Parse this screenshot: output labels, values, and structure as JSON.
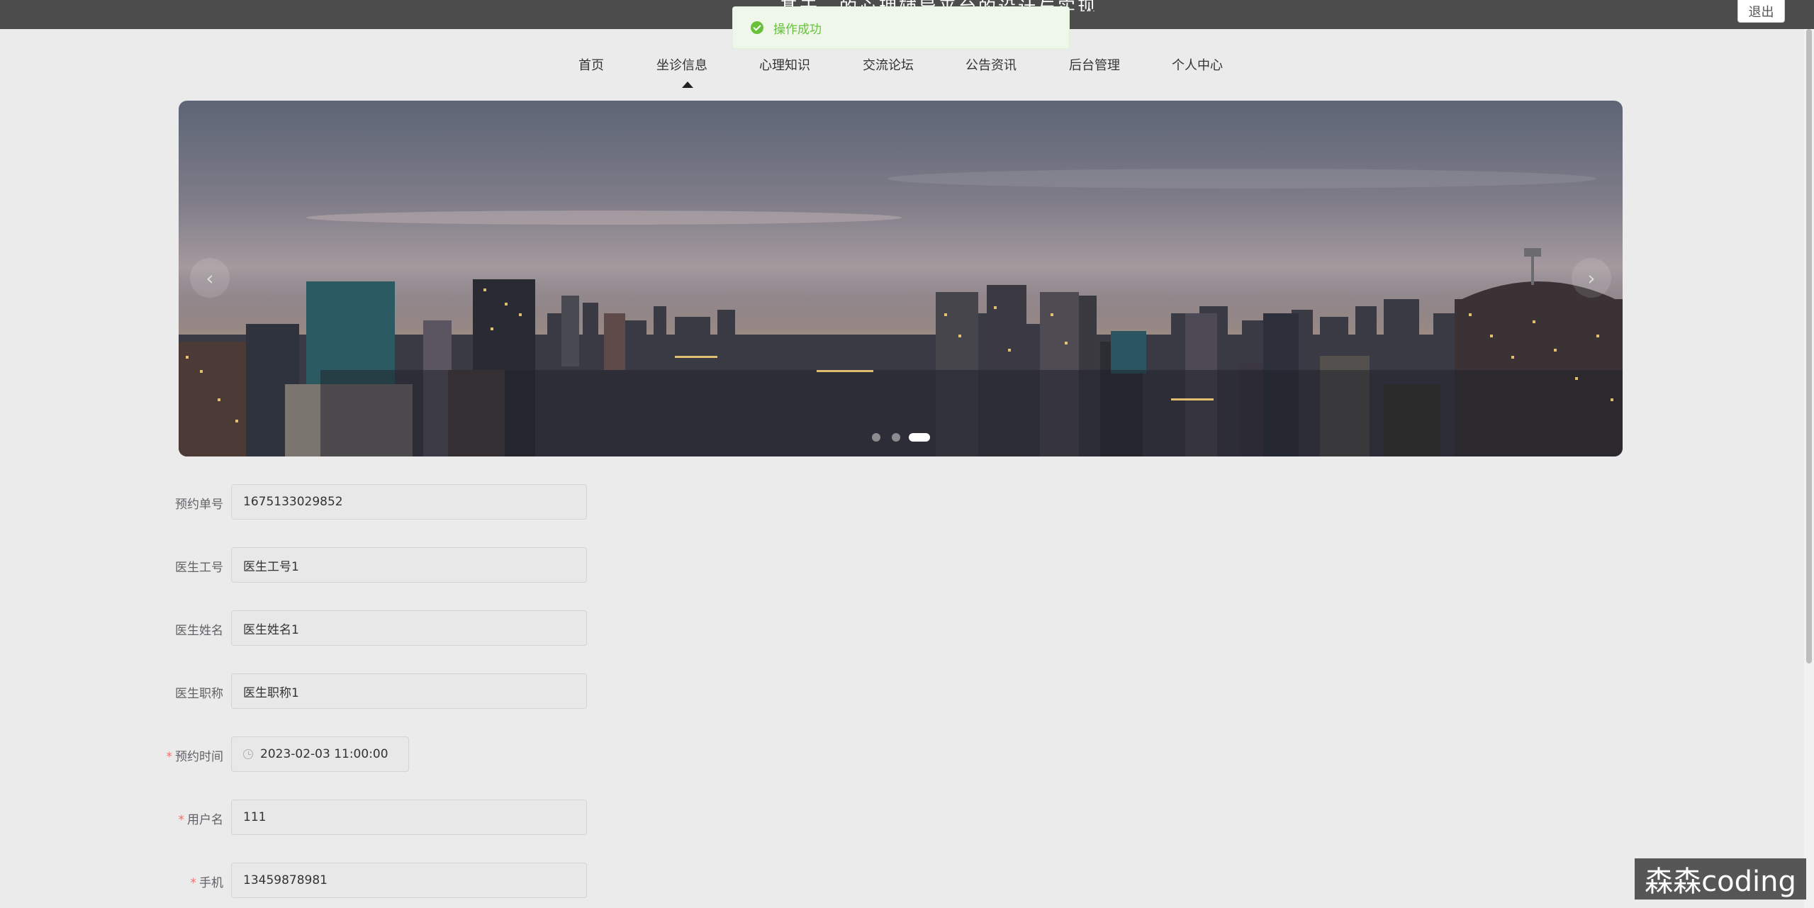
{
  "header": {
    "site_title": "基于…的心理辅导平台的设计与实现",
    "logout_label": "退出"
  },
  "toast": {
    "message": "操作成功",
    "icon": "check-circle-icon",
    "color": "#67c23a"
  },
  "nav": {
    "items": [
      {
        "label": "首页"
      },
      {
        "label": "坐诊信息",
        "active": true
      },
      {
        "label": "心理知识"
      },
      {
        "label": "交流论坛"
      },
      {
        "label": "公告资讯"
      },
      {
        "label": "后台管理"
      },
      {
        "label": "个人中心"
      }
    ]
  },
  "carousel": {
    "prev_label": "‹",
    "next_label": "›",
    "slide_count": 3,
    "active_slide": 3
  },
  "form": {
    "order_no": {
      "label": "预约单号",
      "value": "1675133029852"
    },
    "doctor_id": {
      "label": "医生工号",
      "value": "医生工号1"
    },
    "doctor_name": {
      "label": "医生姓名",
      "value": "医生姓名1"
    },
    "doctor_title": {
      "label": "医生职称",
      "value": "医生职称1"
    },
    "appointment_time": {
      "label": "预约时间",
      "value": "2023-02-03 11:00:00",
      "required_mark": "*"
    },
    "username": {
      "label": "用户名",
      "value": "111",
      "required_mark": "*"
    },
    "phone": {
      "label": "手机",
      "value": "13459878981",
      "required_mark": "*"
    }
  },
  "watermark": {
    "text": "森森coding"
  }
}
